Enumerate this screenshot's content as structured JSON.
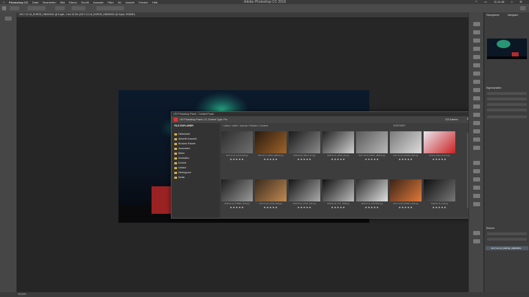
{
  "menubar": {
    "items": [
      "Photoshop CC",
      "Datei",
      "Bearbeiten",
      "Bild",
      "Ebene",
      "Schrift",
      "Auswahl",
      "Filter",
      "3D",
      "Ansicht",
      "Fenster",
      "Hilfe"
    ],
    "app_title": "Adobe Photoshop CC 2018",
    "clock": "11:14:48"
  },
  "doc_tab": {
    "label": "2017-12-16_KHROE_HB000001 @ Kopie, 1 bei 33,3% (2017-12-16_KHROE_HB000001 @ Kopie, RGB/8*)"
  },
  "status": {
    "zoom": "33,33%"
  },
  "plugin": {
    "window_title": "LR/ Photoshop Panel - Content Panel",
    "header_label": "LR/ Photoshop Panel 1.5, Content Type: Pro",
    "file_info": "123 Dateien",
    "breadcrumbs": "/ Users / robbi / Journal / Publish / Content",
    "sort_label": "SORTIERT",
    "sidebar_title": "FILE EXPLORER",
    "folders": [
      "Datenbank",
      "Aktuelle Auswahl",
      "Brushes Pakete",
      "Aussortiert",
      "Bilder",
      "Australien",
      "Drohne",
      "Iceland",
      "Hintergrund",
      "Musik"
    ],
    "thumbs": [
      {
        "name": "2017-12-16_Landschaft.jpg",
        "tone": "#2e2e2e",
        "accent": "#6f6f6f"
      },
      {
        "name": "2017-12-17_PANO_HB0012.jpg",
        "tone": "#2a1a10",
        "accent": "#a0642a"
      },
      {
        "name": "2018-01-05_ARCH_017.jpg",
        "tone": "#1b1b1b",
        "accent": "#8a8a8a"
      },
      {
        "name": "2018-01-07_ARCH_044.jpg",
        "tone": "#222",
        "accent": "#d0d0d0"
      },
      {
        "name": "2017-12-19_FORST_HB0031.jpg",
        "tone": "#5a5a5a",
        "accent": "#b9b9b9"
      },
      {
        "name": "2017-12-20_WINTER_0012.jpg",
        "tone": "#7a7a7a",
        "accent": "#dcdcdc"
      },
      {
        "name": "Content_Panel_Promo.jpg",
        "tone": "#e8e8f0",
        "accent": "#c22"
      },
      {
        "name": "2018-01-02_STREET_0042.jpg",
        "tone": "#1e1e1e",
        "accent": "#9a9a9a"
      },
      {
        "name": "2017-12-22_CAVE_0033.jpg",
        "tone": "#3a2a1c",
        "accent": "#c08a52"
      },
      {
        "name": "2018-01-04_LIGHT_0021.jpg",
        "tone": "#151515",
        "accent": "#aaaaaa"
      },
      {
        "name": "2018-01-09_CITY_0008.jpg",
        "tone": "#111",
        "accent": "#bbbbbb"
      },
      {
        "name": "2018-01-11_PORTRAIT.jpg",
        "tone": "#2d2d2d",
        "accent": "#e0e0e0"
      },
      {
        "name": "2017-12-28_SUNSET_0019.jpg",
        "tone": "#3a2418",
        "accent": "#e07a3a"
      },
      {
        "name": "2018-01-12_CAR.jpg",
        "tone": "#0f0f0f",
        "accent": "#777"
      }
    ],
    "stars": "★★★★★"
  },
  "right_panel": {
    "nav_tab": "Navigator",
    "hist_tab": "Histogramm",
    "props_tab": "Eigenschaften",
    "layers_tab": "Ebenen",
    "layer_name": "2017-12-16_KHROE_HB000001"
  }
}
